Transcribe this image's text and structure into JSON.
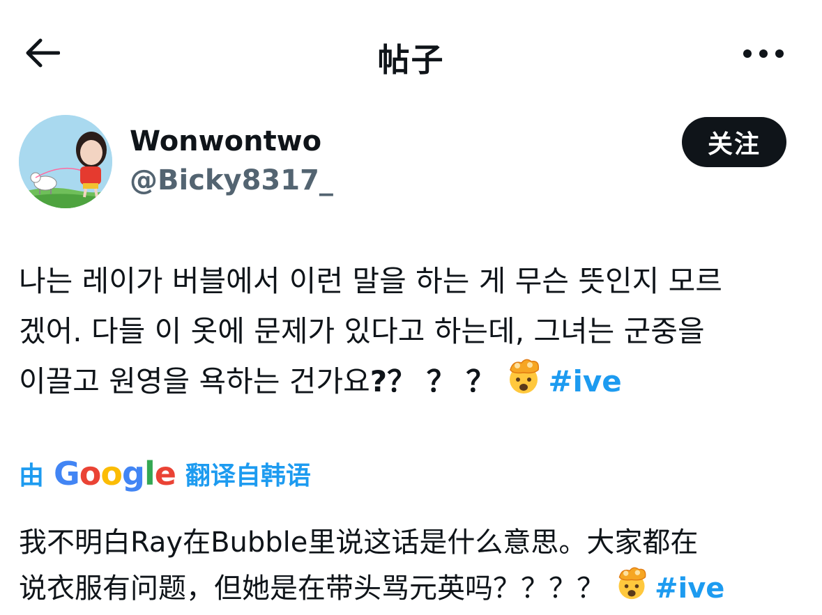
{
  "header": {
    "title": "帖子",
    "back_icon": "arrow-left-icon",
    "more_icon": "more-horizontal-icon"
  },
  "author": {
    "display_name": "Wonwontwo",
    "handle": "@Bicky8317_",
    "follow_label": "关注"
  },
  "post": {
    "lines": [
      "나는 레이가 버블에서 이런 말을 하는 게 무슨 뜻인지 모르",
      "겠어. 다들 이 옷에 문제가 있다고 하는데, 그녀는 군중을",
      "이끌고 원영을 욕하는 건가요"
    ],
    "question_marks": "?？ ？ ？",
    "emoji": "exploding-head-emoji",
    "hashtag": "#ive"
  },
  "translation": {
    "by_prefix": "由",
    "google_letters": [
      "G",
      "o",
      "o",
      "g",
      "l",
      "e"
    ],
    "by_suffix": "翻译自韩语",
    "lines": [
      "我不明白Ray在Bubble里说这话是什么意思。大家都在",
      "说衣服有问题，但她是在带头骂元英吗？？？？"
    ],
    "hashtag": "#ive",
    "emoji": "exploding-head-emoji"
  },
  "colors": {
    "text": "#0f1419",
    "secondary": "#536471",
    "link": "#1d9bf0",
    "button_bg": "#0f1419"
  }
}
